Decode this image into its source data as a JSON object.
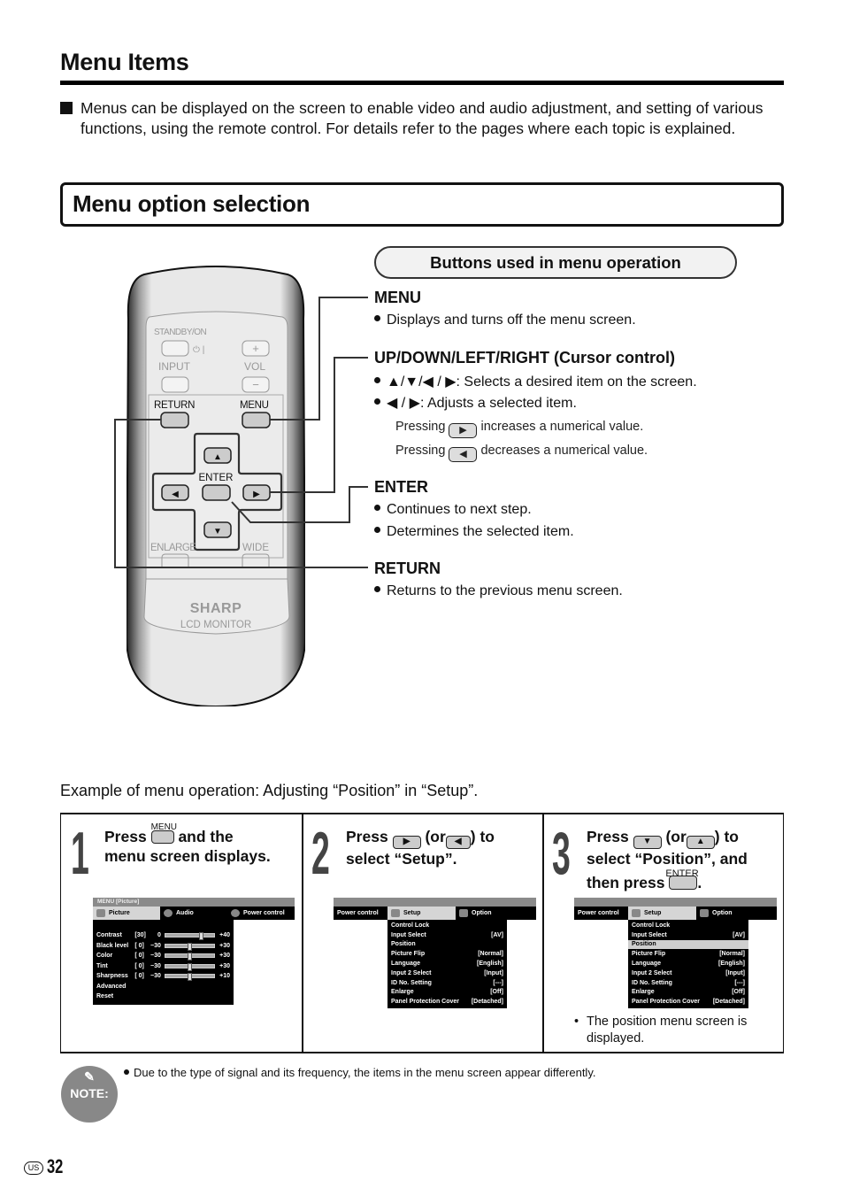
{
  "header": {
    "title": "Menu Items",
    "intro": "Menus can be displayed on the screen to enable video and audio adjustment, and setting of various functions, using the remote control. For details refer to the pages where each topic is explained."
  },
  "section": {
    "title": "Menu option selection"
  },
  "remote": {
    "labels": {
      "standby": "STANDBY/ON",
      "power_symbol": "⏻ |",
      "input": "INPUT",
      "vol": "VOL",
      "plus": "+",
      "minus": "−",
      "return": "RETURN",
      "menu": "MENU",
      "enter": "ENTER",
      "enlarge": "ENLARGE",
      "wide": "WIDE",
      "brand": "SHARP",
      "model": "LCD MONITOR"
    }
  },
  "buttons_panel": {
    "title": "Buttons used in menu operation",
    "items": [
      {
        "heading": "MENU",
        "bullets": [
          "Displays and turns off the menu screen."
        ]
      },
      {
        "heading": "UP/DOWN/LEFT/RIGHT (Cursor control)",
        "bullets": [
          "▲/▼/◀ / ▶: Selects a desired item on the screen.",
          "◀ / ▶: Adjusts a selected item."
        ],
        "notes": [
          {
            "prefix": "Pressing",
            "key": "▶",
            "suffix": "increases a numerical value."
          },
          {
            "prefix": "Pressing",
            "key": "◀",
            "suffix": "decreases a numerical value."
          }
        ]
      },
      {
        "heading": "ENTER",
        "bullets": [
          "Continues to next step.",
          "Determines the selected item."
        ]
      },
      {
        "heading": "RETURN",
        "bullets": [
          "Returns to the previous menu screen."
        ]
      }
    ]
  },
  "example": {
    "caption": "Example of menu operation: Adjusting “Position” in “Setup”.",
    "steps": [
      {
        "number": "1",
        "line1_a": "Press",
        "key_label": "MENU",
        "line1_b": "and the",
        "line2": "menu screen displays."
      },
      {
        "number": "2",
        "line1_a": "Press",
        "key1": "▶",
        "line1_b": "(or",
        "key2": "◀",
        "line1_c": ") to",
        "line2": "select “Setup”."
      },
      {
        "number": "3",
        "line1_a": "Press",
        "key1": "▼",
        "line1_b": "(or",
        "key2": "▲",
        "line1_c": ") to",
        "line2": "select “Position”, and",
        "line3": "then press",
        "key3_label": "ENTER",
        "line3_end": ".",
        "footnote": "The position menu screen is displayed."
      }
    ]
  },
  "menu_screen_1": {
    "header": "MENU [Picture]",
    "tabs": [
      "Picture",
      "Audio",
      "Power control"
    ],
    "active_tab": "Picture",
    "rows": [
      {
        "label": "Contrast",
        "value": "[30]",
        "min": "0",
        "max": "+40",
        "level": 0.75
      },
      {
        "label": "Black level",
        "value": "[ 0]",
        "min": "−30",
        "max": "+30",
        "level": 0.5
      },
      {
        "label": "Color",
        "value": "[ 0]",
        "min": "−30",
        "max": "+30",
        "level": 0.5
      },
      {
        "label": "Tint",
        "value": "[ 0]",
        "min": "−30",
        "max": "+30",
        "level": 0.5
      },
      {
        "label": "Sharpness",
        "value": "[ 0]",
        "min": "−30",
        "max": "+10",
        "level": 0.5
      },
      {
        "label": "Advanced"
      },
      {
        "label": "Reset"
      }
    ]
  },
  "menu_screen_setup": {
    "tabs": [
      "Power control",
      "Setup",
      "Option"
    ],
    "active_tab": "Setup",
    "rows": [
      {
        "label": "Control Lock",
        "value": ""
      },
      {
        "label": "Input Select",
        "value": "[AV]"
      },
      {
        "label": "Position",
        "value": ""
      },
      {
        "label": "Picture Flip",
        "value": "[Normal]"
      },
      {
        "label": "Language",
        "value": "[English]"
      },
      {
        "label": "Input 2 Select",
        "value": "[Input]"
      },
      {
        "label": "ID No. Setting",
        "value": "[---]"
      },
      {
        "label": "Enlarge",
        "value": "[Off]"
      },
      {
        "label": "Panel Protection Cover",
        "value": "[Detached]"
      }
    ],
    "selected_in_step3": "Position"
  },
  "note": {
    "label": "NOTE:",
    "text": "Due to the type of signal and its frequency, the items in the menu screen appear differently."
  },
  "footer": {
    "region": "US",
    "page_number": "32"
  }
}
